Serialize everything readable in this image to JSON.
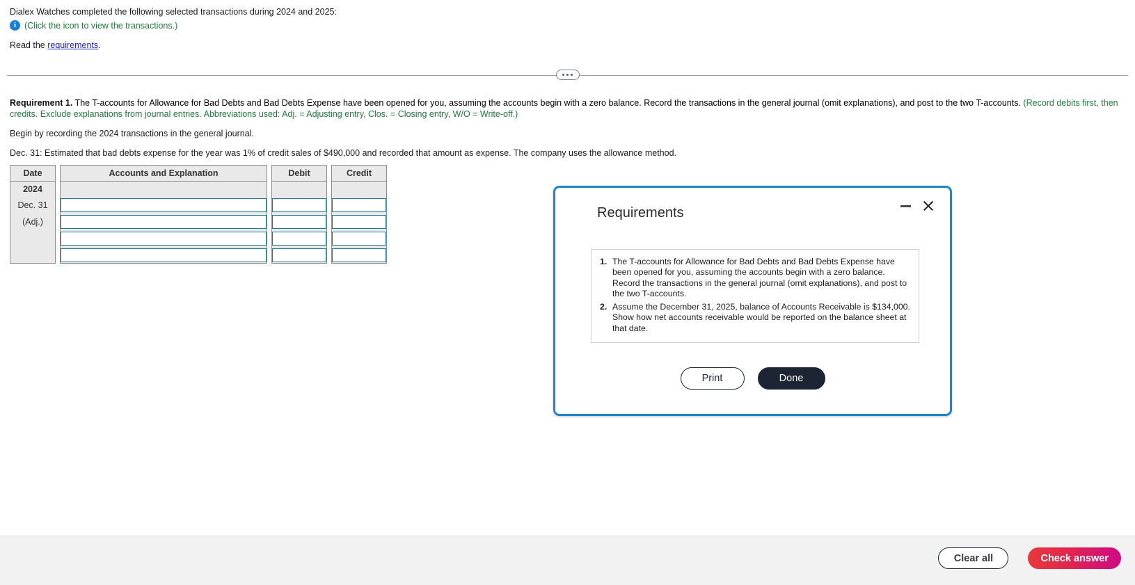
{
  "problem": {
    "intro": "Dialex Watches completed the following selected transactions during 2024 and 2025:",
    "icon_note": "(Click the icon to view the transactions.)",
    "info_icon_glyph": "i",
    "read_prefix": "Read the ",
    "read_link": "requirements",
    "read_suffix": "."
  },
  "requirement": {
    "label": "Requirement 1.",
    "body": " The T-accounts for Allowance for Bad Debts and Bad Debts Expense have been opened for you, assuming the accounts begin with a zero balance. Record the transactions in the general journal (omit explanations), and post to the two T-accounts. ",
    "green_note": "(Record debits first, then credits. Exclude explanations from journal entries. Abbreviations used: Adj. = Adjusting entry, Clos. = Closing entry, W/O = Write-off.)",
    "begin_text": "Begin by recording the 2024 transactions in the general journal.",
    "transaction_text": "Dec. 31: Estimated that bad debts expense for the year was 1% of credit sales of $490,000 and recorded that amount as expense. The company uses the allowance method."
  },
  "journal": {
    "headers": {
      "date": "Date",
      "accounts": "Accounts and Explanation",
      "debit": "Debit",
      "credit": "Credit"
    },
    "date_labels": [
      "2024",
      "Dec. 31",
      "(Adj.)",
      "",
      ""
    ],
    "rows": [
      {
        "accounts": "",
        "debit": "",
        "credit": ""
      },
      {
        "accounts": "",
        "debit": "",
        "credit": ""
      },
      {
        "accounts": "",
        "debit": "",
        "credit": ""
      },
      {
        "accounts": "",
        "debit": "",
        "credit": ""
      }
    ]
  },
  "modal": {
    "title": "Requirements",
    "minimize_icon": "minimize-icon",
    "close_icon": "close-icon",
    "items": [
      {
        "number": "1.",
        "text": "The T-accounts for Allowance for Bad Debts and Bad Debts Expense have been opened for you, assuming the accounts begin with a zero balance. Record the transactions in the general journal (omit explanations), and post to the two T-accounts."
      },
      {
        "number": "2.",
        "text": "Assume the December 31, 2025, balance of Accounts Receivable is $134,000. Show how net accounts receivable would be reported on the balance sheet at that date."
      }
    ],
    "print_label": "Print",
    "done_label": "Done"
  },
  "footer": {
    "clear_label": "Clear all",
    "check_label": "Check answer"
  },
  "colors": {
    "link": "#2222cc",
    "green_note": "#1f7a3d",
    "modal_border": "#1e86c8",
    "input_border": "#1b7a94",
    "check_gradient_start": "#e8393c",
    "check_gradient_end": "#cf0b84",
    "done_bg": "#1d2433"
  }
}
